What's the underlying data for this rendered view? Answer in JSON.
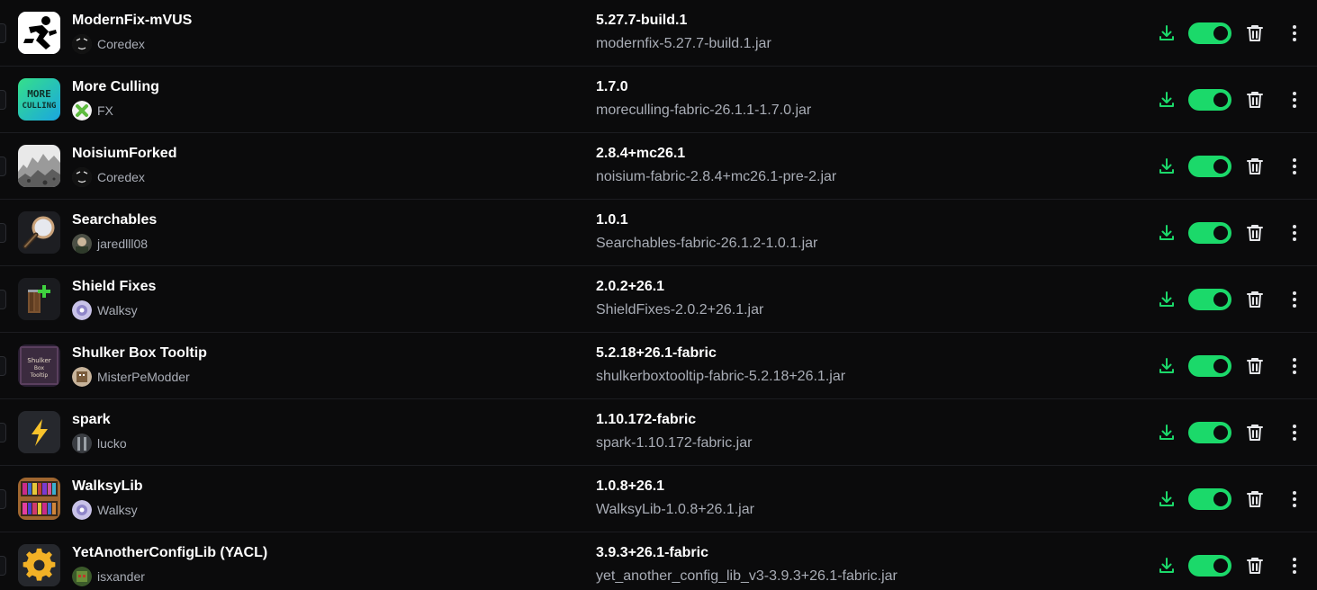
{
  "colors": {
    "background": "#0b0b0c",
    "accent": "#1bd96a",
    "primary_text": "#ffffff",
    "secondary_text": "#a9adb6"
  },
  "mods": [
    {
      "name": "ModernFix-mVUS",
      "author": "Coredex",
      "version": "5.27.7-build.1",
      "file": "modernfix-5.27.7-build.1.jar",
      "icon": "running-man-icon",
      "avatar": "coredex-avatar",
      "enabled": true
    },
    {
      "name": "More Culling",
      "author": "FX",
      "version": "1.7.0",
      "file": "moreculling-fabric-26.1.1-1.7.0.jar",
      "icon": "more-culling-icon",
      "avatar": "fx-avatar",
      "enabled": true
    },
    {
      "name": "NoisiumForked",
      "author": "Coredex",
      "version": "2.8.4+mc26.1",
      "file": "noisium-fabric-2.8.4+mc26.1-pre-2.jar",
      "icon": "terrain-icon",
      "avatar": "coredex-avatar",
      "enabled": true
    },
    {
      "name": "Searchables",
      "author": "jaredlll08",
      "version": "1.0.1",
      "file": "Searchables-fabric-26.1.2-1.0.1.jar",
      "icon": "magnifier-icon",
      "avatar": "jared-avatar",
      "enabled": true
    },
    {
      "name": "Shield Fixes",
      "author": "Walksy",
      "version": "2.0.2+26.1",
      "file": "ShieldFixes-2.0.2+26.1.jar",
      "icon": "shield-plus-icon",
      "avatar": "walksy-avatar",
      "enabled": true
    },
    {
      "name": "Shulker Box Tooltip",
      "author": "MisterPeModder",
      "version": "5.2.18+26.1-fabric",
      "file": "shulkerboxtooltip-fabric-5.2.18+26.1.jar",
      "icon": "shulker-box-icon",
      "avatar": "misterpemodder-avatar",
      "enabled": true
    },
    {
      "name": "spark",
      "author": "lucko",
      "version": "1.10.172-fabric",
      "file": "spark-1.10.172-fabric.jar",
      "icon": "lightning-icon",
      "avatar": "lucko-avatar",
      "enabled": true
    },
    {
      "name": "WalksyLib",
      "author": "Walksy",
      "version": "1.0.8+26.1",
      "file": "WalksyLib-1.0.8+26.1.jar",
      "icon": "bookshelf-icon",
      "avatar": "walksy-avatar",
      "enabled": true
    },
    {
      "name": "YetAnotherConfigLib (YACL)",
      "author": "isxander",
      "version": "3.9.3+26.1-fabric",
      "file": "yet_another_config_lib_v3-3.9.3+26.1-fabric.jar",
      "icon": "gear-icon",
      "avatar": "isxander-avatar",
      "enabled": true
    }
  ],
  "shicon_text": {
    "more_culling": "MORE CULLING",
    "shulker": "Shulker Box Tooltip"
  }
}
